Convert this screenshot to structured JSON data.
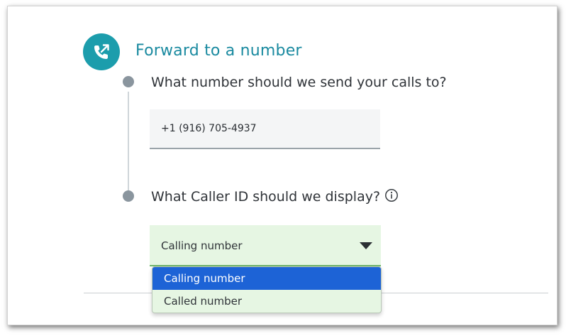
{
  "section": {
    "title": "Forward to a number",
    "icon": "phone-forward-icon"
  },
  "steps": [
    {
      "question": "What number should we send your calls to?",
      "input_value": "+1 (916) 705-4937"
    },
    {
      "question": "What Caller ID should we display?",
      "info_icon": "info-icon",
      "selected": "Calling number",
      "options": [
        {
          "label": "Calling number",
          "highlighted": true
        },
        {
          "label": "Called number",
          "highlighted": false
        }
      ]
    }
  ],
  "colors": {
    "accent": "#1c9dac",
    "title": "#1a8aa0",
    "select_background": "#e6f6e3",
    "option_highlight": "#1d63d6",
    "step_dot": "#8a959e"
  }
}
